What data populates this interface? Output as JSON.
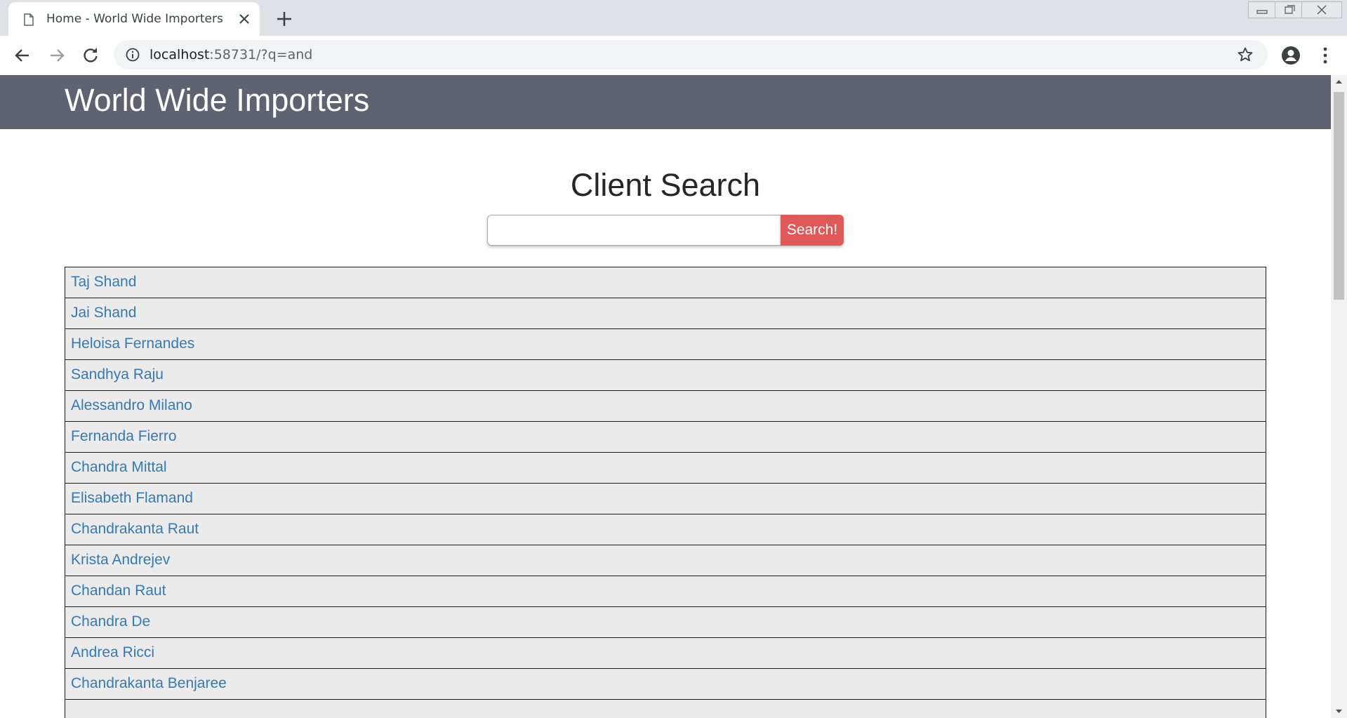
{
  "browser": {
    "tab_title": "Home - World Wide Importers",
    "url_host": "localhost",
    "url_rest": ":58731/?q=and"
  },
  "header": {
    "site_title": "World Wide Importers"
  },
  "search": {
    "heading": "Client Search",
    "input_value": "",
    "button_label": "Search!"
  },
  "results": [
    "Taj Shand",
    "Jai Shand",
    "Heloisa Fernandes",
    "Sandhya Raju",
    "Alessandro Milano",
    "Fernanda Fierro",
    "Chandra Mittal",
    "Elisabeth Flamand",
    "Chandrakanta Raut",
    "Krista Andrejev",
    "Chandan Raut",
    "Chandra De",
    "Andrea Ricci",
    "Chandrakanta Benjaree",
    ""
  ],
  "colors": {
    "header_bg": "#5f6271",
    "button_bg": "#e05858",
    "link": "#337ab7",
    "row_bg": "#ebebeb"
  }
}
